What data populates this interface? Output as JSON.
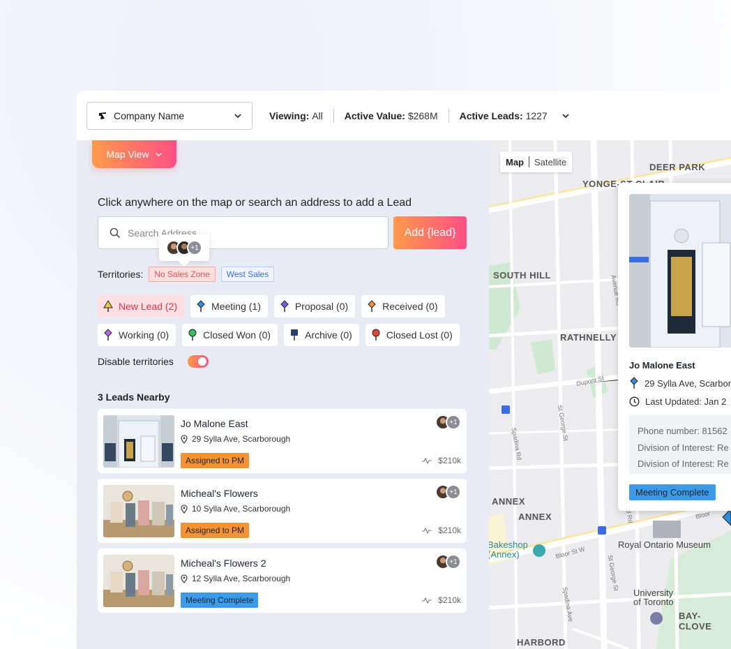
{
  "topbar": {
    "company_name": "Company Name",
    "viewing_label": "Viewing:",
    "viewing_value": "All",
    "active_value_label": "Active Value:",
    "active_value": "$268M",
    "active_leads_label": "Active Leads:",
    "active_leads": "1227"
  },
  "left": {
    "map_view_button": "Map View",
    "instruction": "Click anywhere on the map or search an address to add a Lead",
    "search_placeholder": "Search Address",
    "add_button": "Add {lead}",
    "avatar_more": "+1",
    "territories_label": "Territories:",
    "territories": [
      "No Sales Zone",
      "West Sales"
    ],
    "statuses": [
      {
        "label": "New Lead (2)",
        "color": "#f5c542",
        "active": true,
        "icon": "triangle-pin-icon"
      },
      {
        "label": "Meeting (1)",
        "color": "#2f8fe0",
        "icon": "diamond-pin-icon"
      },
      {
        "label": "Proposal (0)",
        "color": "#7a5cf0",
        "icon": "diamond-pin-icon"
      },
      {
        "label": "Received (0)",
        "color": "#f59234",
        "icon": "diamond-pin-icon"
      },
      {
        "label": "Working (0)",
        "color": "#b16ee8",
        "icon": "diamond-pin-icon"
      },
      {
        "label": "Closed Won (0)",
        "color": "#33c253",
        "icon": "round-pin-icon"
      },
      {
        "label": "Archive (0)",
        "color": "#2c3e6b",
        "icon": "flag-pin-icon"
      },
      {
        "label": "Closed Lost (0)",
        "color": "#e0453c",
        "icon": "round-pin-icon"
      }
    ],
    "disable_territories": "Disable territories",
    "nearby_title": "3 Leads Nearby",
    "leads": [
      {
        "name": "Jo Malone East",
        "address": "29 Sylla Ave, Scarborough",
        "status": "Assigned to PM",
        "status_color": "orange",
        "avatar_more": "+1",
        "value": "$210k"
      },
      {
        "name": "Micheal's Flowers",
        "address": "10 Sylla Ave, Scarborough",
        "status": "Assigned to PM",
        "status_color": "orange",
        "avatar_more": "+1",
        "value": "$210k"
      },
      {
        "name": "Micheal's Flowers 2",
        "address": "12 Sylla Ave, Scarborough",
        "status": "Meeting Complete",
        "status_color": "blue",
        "avatar_more": "+1",
        "value": "$210k"
      }
    ]
  },
  "map": {
    "map_tab": "Map",
    "satellite_tab": "Satellite",
    "labels": {
      "deer_park": "DEER PARK",
      "yonge": "YONGE-ST CLAIR",
      "south_hill": "SOUTH HILL",
      "rathnelly": "RATHNELLY",
      "annex1": "ANNEX",
      "annex2": "ANNEX",
      "bakeshop": "Bakeshop\n(Annex)",
      "rom": "Royal Ontario Museum",
      "uoft": "University\nof Toronto",
      "bay_clov": "BAY-CLOVE",
      "harbord": "HARBORD",
      "avenue_rd": "Avenue Rd",
      "dupont": "Dupont St",
      "spadina": "Spadina Rd",
      "st_george": "St George St",
      "bloor1": "Bloor St W",
      "bloor2": "Bloor",
      "st_george2": "St George St",
      "spadina_ave": "Spadina Ave",
      "ave_rd2": "d Rd"
    },
    "popup": {
      "name": "Jo Malone East",
      "address": "29 Sylla Ave, Scarboro",
      "last_updated": "Last Updated: Jan 2",
      "info": [
        "Phone number: 81562",
        "Division of Interest: Re",
        "Division of Interest: Re"
      ],
      "status": "Meeting Complete"
    }
  }
}
